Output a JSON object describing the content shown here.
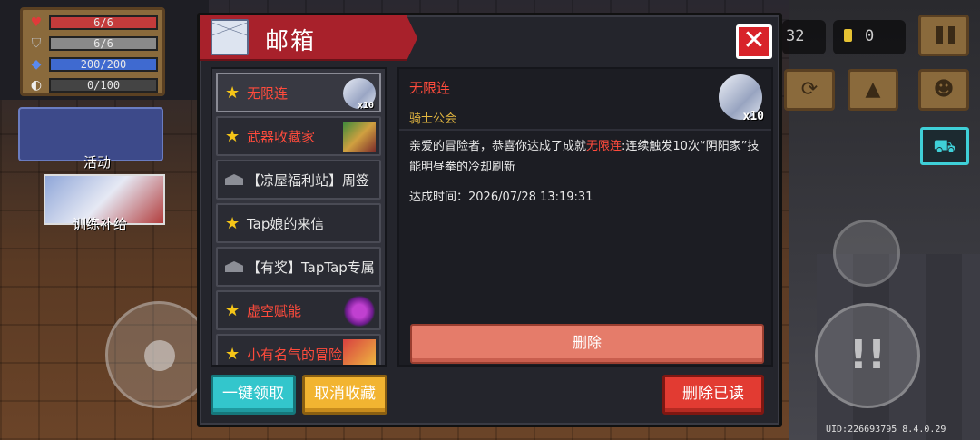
{
  "hud": {
    "hp": "6/6",
    "armor": "6/6",
    "energy": "200/200",
    "skill": "0/100",
    "activity_label": "活动",
    "training_label": "训练补给",
    "gems": "32",
    "coins": "0",
    "uid": "UID:226693795 8.4.0.29"
  },
  "mailbox": {
    "title": "邮箱",
    "close_label": "✕",
    "items": [
      {
        "label": "无限连",
        "type": "star",
        "color": "red",
        "thumb": "angel",
        "badge": "x10"
      },
      {
        "label": "武器收藏家",
        "type": "star",
        "color": "red",
        "thumb": "weapon",
        "badge": ""
      },
      {
        "label": "【凉屋福利站】周签",
        "type": "envelope",
        "color": "white",
        "thumb": "",
        "badge": ""
      },
      {
        "label": "Tap娘的来信",
        "type": "star",
        "color": "white",
        "thumb": "",
        "badge": ""
      },
      {
        "label": "【有奖】TapTap专属",
        "type": "envelope",
        "color": "white",
        "thumb": "",
        "badge": ""
      },
      {
        "label": "虚空赋能",
        "type": "star",
        "color": "red",
        "thumb": "void",
        "badge": ""
      },
      {
        "label": "小有名气的冒险家",
        "type": "star",
        "color": "red",
        "thumb": "gift",
        "badge": ""
      }
    ],
    "detail": {
      "title": "无限连",
      "sender": "骑士公会",
      "badge": "x10",
      "body_prefix": "亲爱的冒险者，恭喜你达成了成就",
      "body_highlight": "无限连",
      "body_suffix": ":连续触发10次“阴阳家”技能明昼拳的冷却刷新",
      "time": "达成时间：2026/07/28 13:19:31",
      "delete_label": "删除"
    },
    "buttons": {
      "claim_all": "一键领取",
      "unfavorite": "取消收藏",
      "delete_read": "删除已读"
    }
  },
  "colors": {
    "accent_red": "#ff4b3c",
    "header_red": "#a8212b",
    "claim_cyan": "#33c6cc",
    "unfav_orange": "#f2b431",
    "delete_red": "#e23b32",
    "delete_salmon": "#e57c6a",
    "sender_gold": "#e2b640"
  }
}
